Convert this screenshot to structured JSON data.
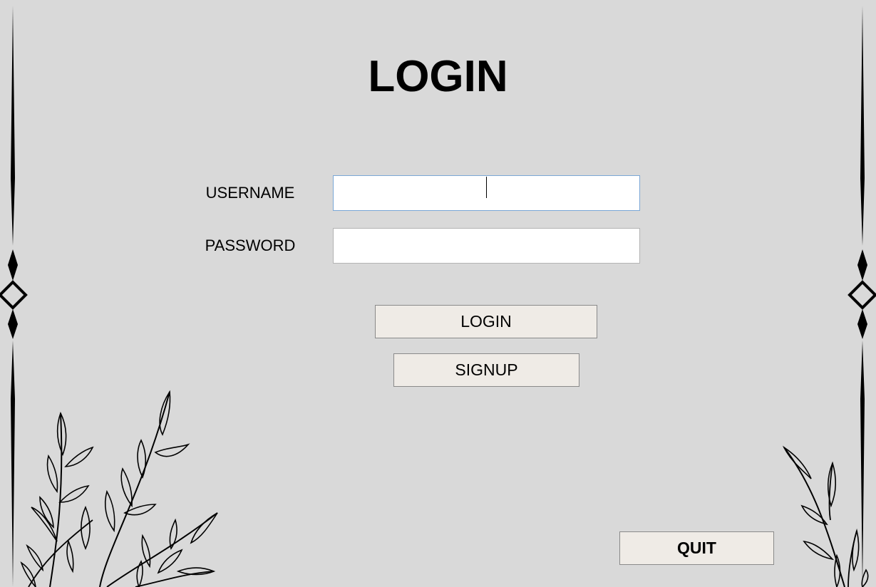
{
  "title": "LOGIN",
  "form": {
    "username_label": "USERNAME",
    "username_value": "",
    "password_label": "PASSWORD",
    "password_value": ""
  },
  "buttons": {
    "login": "LOGIN",
    "signup": "SIGNUP",
    "quit": "QUIT"
  },
  "colors": {
    "background": "#d9d9d9",
    "button_fill": "#efebe6",
    "focus_border": "#7aa7d6"
  }
}
